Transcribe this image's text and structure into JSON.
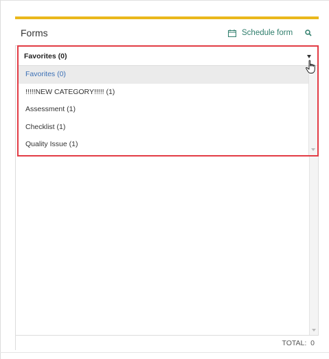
{
  "header": {
    "title": "Forms",
    "schedule_label": "Schedule form",
    "schedule_icon": "calendar-icon",
    "search_icon": "search-icon"
  },
  "dropdown": {
    "selected": "Favorites (0)",
    "options": [
      "Favorites (0)",
      "!!!!!NEW CATEGORY!!!!! (1)",
      "Assessment (1)",
      "Checklist (1)",
      "Quality Issue (1)"
    ]
  },
  "footer": {
    "total_label": "TOTAL:",
    "total_value": "0"
  },
  "colors": {
    "accent": "#eab81c",
    "link": "#2e7d6b",
    "highlight_border": "#e23b44",
    "selected_text": "#3a6fb5"
  }
}
